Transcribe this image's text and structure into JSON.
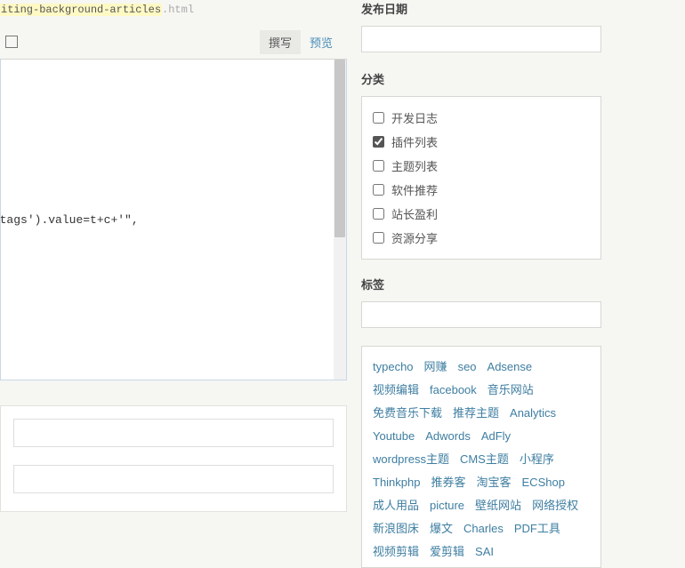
{
  "slug": {
    "highlighted": "iting-background-articles",
    "ext": ".html"
  },
  "editorTabs": {
    "write": "撰写",
    "preview": "预览"
  },
  "editorContent": "')->stack;\n\n\n\n';document.getElementById('tags').value=t+c+'\",",
  "sidebar": {
    "publishDate": {
      "label": "发布日期"
    },
    "categories": {
      "label": "分类",
      "items": [
        {
          "label": "开发日志",
          "checked": false
        },
        {
          "label": "插件列表",
          "checked": true
        },
        {
          "label": "主题列表",
          "checked": false
        },
        {
          "label": "软件推荐",
          "checked": false
        },
        {
          "label": "站长盈利",
          "checked": false
        },
        {
          "label": "资源分享",
          "checked": false
        }
      ]
    },
    "tags": {
      "label": "标签",
      "cloud": [
        "typecho",
        "网赚",
        "seo",
        "Adsense",
        "视频编辑",
        "facebook",
        "音乐网站",
        "免费音乐下载",
        "推荐主题",
        "Analytics",
        "Youtube",
        "Adwords",
        "AdFly",
        "wordpress主题",
        "CMS主题",
        "小程序",
        "Thinkphp",
        "推券客",
        "淘宝客",
        "ECShop",
        "成人用品",
        "picture",
        "壁纸网站",
        "网络授权",
        "新浪图床",
        "爆文",
        "Charles",
        "PDF工具",
        "视频剪辑",
        "爱剪辑",
        "SAI"
      ]
    }
  }
}
